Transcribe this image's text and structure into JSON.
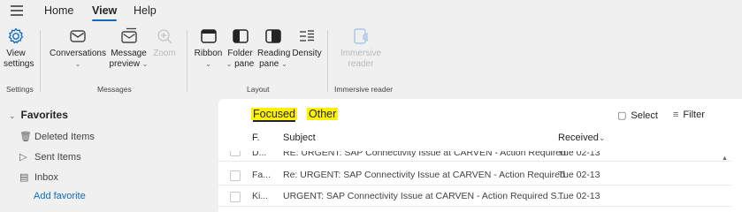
{
  "nav": {
    "tabs": [
      "Home",
      "View",
      "Help"
    ],
    "active": "View"
  },
  "ribbon": {
    "view_settings": [
      "View",
      "settings"
    ],
    "conversations": "Conversations",
    "message_preview": [
      "Message",
      "preview"
    ],
    "zoom": "Zoom",
    "ribbon": "Ribbon",
    "folder_pane": [
      "Folder",
      "pane"
    ],
    "reading_pane": [
      "Reading",
      "pane"
    ],
    "density": "Density",
    "immersive_reader": [
      "Immersive",
      "reader"
    ],
    "groups": [
      "Settings",
      "Messages",
      "Layout",
      "Immersive reader"
    ]
  },
  "favorites": {
    "header": "Favorites",
    "items": [
      "Deleted Items",
      "Sent Items",
      "Inbox"
    ],
    "add": "Add favorite"
  },
  "messages": {
    "pivots": {
      "focused": "Focused",
      "other": "Other"
    },
    "select_label": "Select",
    "filter_label": "Filter",
    "columns": {
      "from": "F.",
      "subject": "Subject",
      "received": "Received"
    },
    "rows": [
      {
        "from": "D...",
        "subject": "RE: URGENT: SAP Connectivity Issue at CARVEN - Action Required",
        "date": "Tue 02-13"
      },
      {
        "from": "Fa...",
        "subject": "Re: URGENT: SAP Connectivity Issue at CARVEN - Action Required",
        "date": "Tue 02-13"
      },
      {
        "from": "Ki...",
        "subject": "URGENT: SAP Connectivity Issue at CARVEN - Action Required   S...",
        "date": "Tue 02-13"
      }
    ]
  }
}
